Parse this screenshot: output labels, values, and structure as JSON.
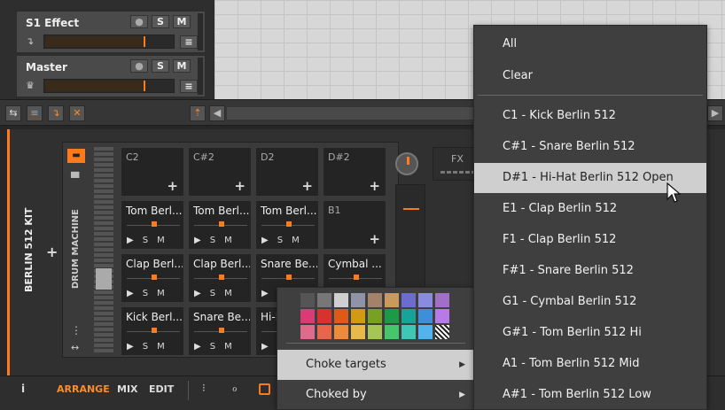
{
  "tracks": [
    {
      "name": "S1 Effect",
      "solo": "S",
      "mute": "M"
    },
    {
      "name": "Master",
      "solo": "S",
      "mute": "M"
    }
  ],
  "device": {
    "name": "BERLIN 512 KIT",
    "type": "DRUM MACHINE",
    "fx_label": "FX"
  },
  "pads": [
    {
      "label": "C2",
      "filled": false
    },
    {
      "label": "C#2",
      "filled": false
    },
    {
      "label": "D2",
      "filled": false
    },
    {
      "label": "D#2",
      "filled": false
    },
    {
      "label": "Tom Berl...",
      "filled": true
    },
    {
      "label": "Tom Berl...",
      "filled": true
    },
    {
      "label": "Tom Berl...",
      "filled": true
    },
    {
      "label": "B1",
      "filled": false
    },
    {
      "label": "Clap Berl...",
      "filled": true
    },
    {
      "label": "Clap Berl...",
      "filled": true
    },
    {
      "label": "Snare Be...",
      "filled": true
    },
    {
      "label": "Cymbal ...",
      "filled": true
    },
    {
      "label": "Kick Berl...",
      "filled": true
    },
    {
      "label": "Snare Be...",
      "filled": true
    },
    {
      "label": "Hi-H",
      "filled": true
    }
  ],
  "pad_controls": {
    "play": "▶",
    "solo": "S",
    "mute": "M"
  },
  "plus": "+",
  "bottom_bar": {
    "info": "i",
    "arrange": "ARRANGE",
    "mix": "MIX",
    "edit": "EDIT"
  },
  "color_swatches": [
    "#555555",
    "#777777",
    "#cfcfcf",
    "#8f92a8",
    "#a4826a",
    "#c99a5c",
    "#6b6bd0",
    "#8a8ae0",
    "#a070c8",
    "#d83b75",
    "#d8322f",
    "#e05a17",
    "#d29a14",
    "#78a021",
    "#1d9a45",
    "#17a39a",
    "#3c8fd8",
    "#b77ae8",
    "#e06a8c",
    "#e8644a",
    "#ee8a3a",
    "#e8b84a",
    "#a6c653",
    "#45c66a",
    "#3cc8b4",
    "#52b4ee",
    "pattern"
  ],
  "context_menu": {
    "items": [
      "Choke targets",
      "Choked by"
    ],
    "arrow": "▶"
  },
  "submenu": {
    "top_items": [
      "All",
      "Clear"
    ],
    "items": [
      "C1 - Kick Berlin 512",
      "C#1 - Snare Berlin 512",
      "D#1 - Hi-Hat Berlin 512 Open",
      "E1 - Clap Berlin 512",
      "F1 - Clap Berlin 512",
      "F#1 - Snare Berlin 512",
      "G1 - Cymbal Berlin 512",
      "G#1 - Tom Berlin 512 Hi",
      "A1 - Tom Berlin 512 Mid",
      "A#1 - Tom Berlin 512 Low"
    ],
    "highlighted_index": 2
  },
  "colors": {
    "accent": "#ff7a1a",
    "menu_bg": "#3f3f3f",
    "highlight": "#cfcfcf"
  }
}
